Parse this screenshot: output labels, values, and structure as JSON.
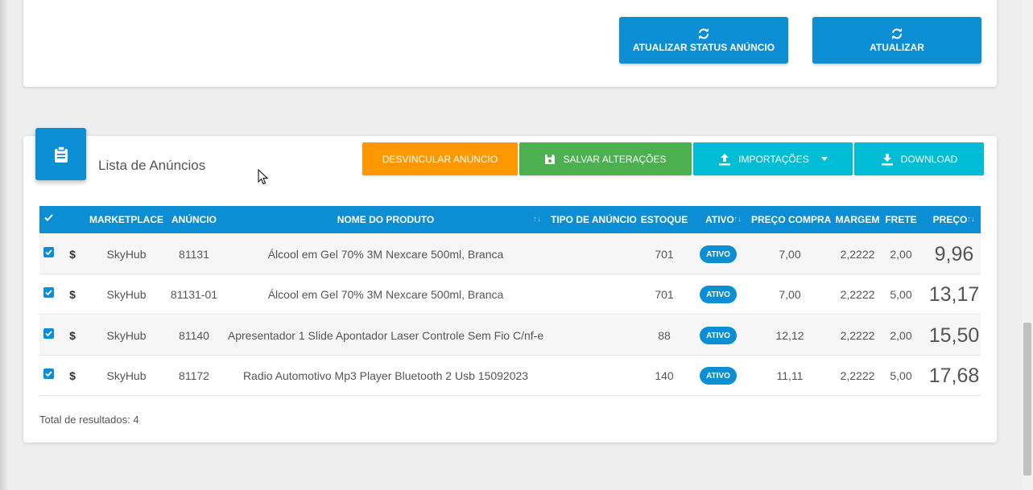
{
  "top_actions": {
    "refresh_status_label": "ATUALIZAR STATUS ANÚNCIO",
    "refresh_label": "ATUALIZAR"
  },
  "list": {
    "title": "Lista de Anúncios",
    "actions": {
      "unlink": "DESVINCULAR ANÚNCIO",
      "save": "SALVAR ALTERAÇÕES",
      "imports": "IMPORTAÇÕES",
      "download": "DOWNLOAD"
    },
    "colors": {
      "primary": "#0c8ed4",
      "unlink": "#ff9800",
      "save": "#4caf50",
      "cyan": "#00bcd4"
    },
    "columns": {
      "marketplace": "MARKETPLACE",
      "anuncio": "ANÚNCIO",
      "nome": "NOME DO PRODUTO",
      "tipo": "TIPO DE ANÚNCIO",
      "estoque": "ESTOQUE",
      "ativo": "ATIVO",
      "preco_compra": "PREÇO COMPRA",
      "margem": "MARGEM",
      "frete": "FRETE",
      "preco": "PREÇO"
    },
    "rows": [
      {
        "currency": "$",
        "marketplace": "SkyHub",
        "anuncio": "81131",
        "nome": "Álcool em Gel 70% 3M Nexcare 500ml, Branca",
        "tipo": "",
        "estoque": "701",
        "ativo": "ATIVO",
        "preco_compra": "7,00",
        "margem": "2,2222",
        "frete": "2,00",
        "preco": "9,96"
      },
      {
        "currency": "$",
        "marketplace": "SkyHub",
        "anuncio": "81131-01",
        "nome": "Álcool em Gel 70% 3M Nexcare 500ml, Branca",
        "tipo": "",
        "estoque": "701",
        "ativo": "ATIVO",
        "preco_compra": "7,00",
        "margem": "2,2222",
        "frete": "5,00",
        "preco": "13,17"
      },
      {
        "currency": "$",
        "marketplace": "SkyHub",
        "anuncio": "81140",
        "nome": "Apresentador 1 Slide Apontador Laser Controle Sem Fio C/nf-e",
        "tipo": "",
        "estoque": "88",
        "ativo": "ATIVO",
        "preco_compra": "12,12",
        "margem": "2,2222",
        "frete": "2,00",
        "preco": "15,50"
      },
      {
        "currency": "$",
        "marketplace": "SkyHub",
        "anuncio": "81172",
        "nome": "Radio Automotivo Mp3 Player Bluetooth 2 Usb 15092023",
        "tipo": "",
        "estoque": "140",
        "ativo": "ATIVO",
        "preco_compra": "11,11",
        "margem": "2,2222",
        "frete": "5,00",
        "preco": "17,68"
      }
    ],
    "total_label": "Total de resultados: 4"
  }
}
